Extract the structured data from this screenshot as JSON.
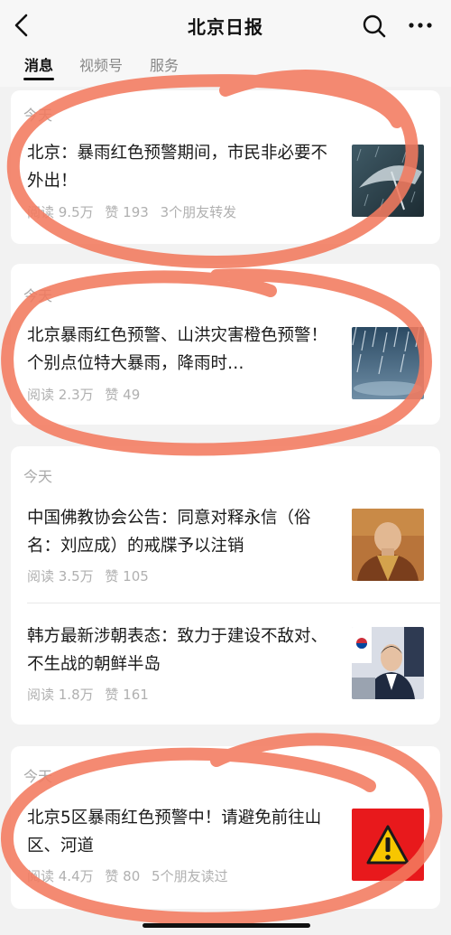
{
  "header": {
    "back_icon": "chevron-left-icon",
    "title": "北京日报",
    "search_icon": "search-icon",
    "more_icon": "more-dots-icon"
  },
  "tabs": [
    {
      "label": "消息",
      "active": true
    },
    {
      "label": "视频号",
      "active": false
    },
    {
      "label": "服务",
      "active": false
    }
  ],
  "cards": [
    {
      "date": "今天",
      "articles": [
        {
          "title": "北京：暴雨红色预警期间，市民非必要不外出！",
          "reads": "阅读 9.5万",
          "likes": "赞 193",
          "extra": "3个朋友转发",
          "thumb": "umbrella-rain-image"
        }
      ]
    },
    {
      "date": "今天",
      "articles": [
        {
          "title": "北京暴雨红色预警、山洪灾害橙色预警！个别点位特大暴雨，降雨时…",
          "reads": "阅读 2.3万",
          "likes": "赞 49",
          "extra": "",
          "thumb": "heavy-rain-image"
        }
      ]
    },
    {
      "date": "今天",
      "articles": [
        {
          "title": "中国佛教协会公告：同意对释永信（俗名：刘应成）的戒牒予以注销",
          "reads": "阅读 3.5万",
          "likes": "赞 105",
          "extra": "",
          "thumb": "monk-portrait-image"
        },
        {
          "title": "韩方最新涉朝表态：致力于建设不敌对、不生战的朝鲜半岛",
          "reads": "阅读 1.8万",
          "likes": "赞 161",
          "extra": "",
          "thumb": "press-conference-image"
        }
      ]
    },
    {
      "date": "今天",
      "articles": [
        {
          "title": "北京5区暴雨红色预警中！请避免前往山区、河道",
          "reads": "阅读 4.4万",
          "likes": "赞 80",
          "extra": "5个朋友读过",
          "thumb": "warning-sign-image"
        }
      ]
    }
  ],
  "colors": {
    "background": "#f2f2f2",
    "card": "#ffffff",
    "annotation_circle": "#f27a5e",
    "warning_red": "#e8191c",
    "warning_yellow": "#f7c600"
  }
}
